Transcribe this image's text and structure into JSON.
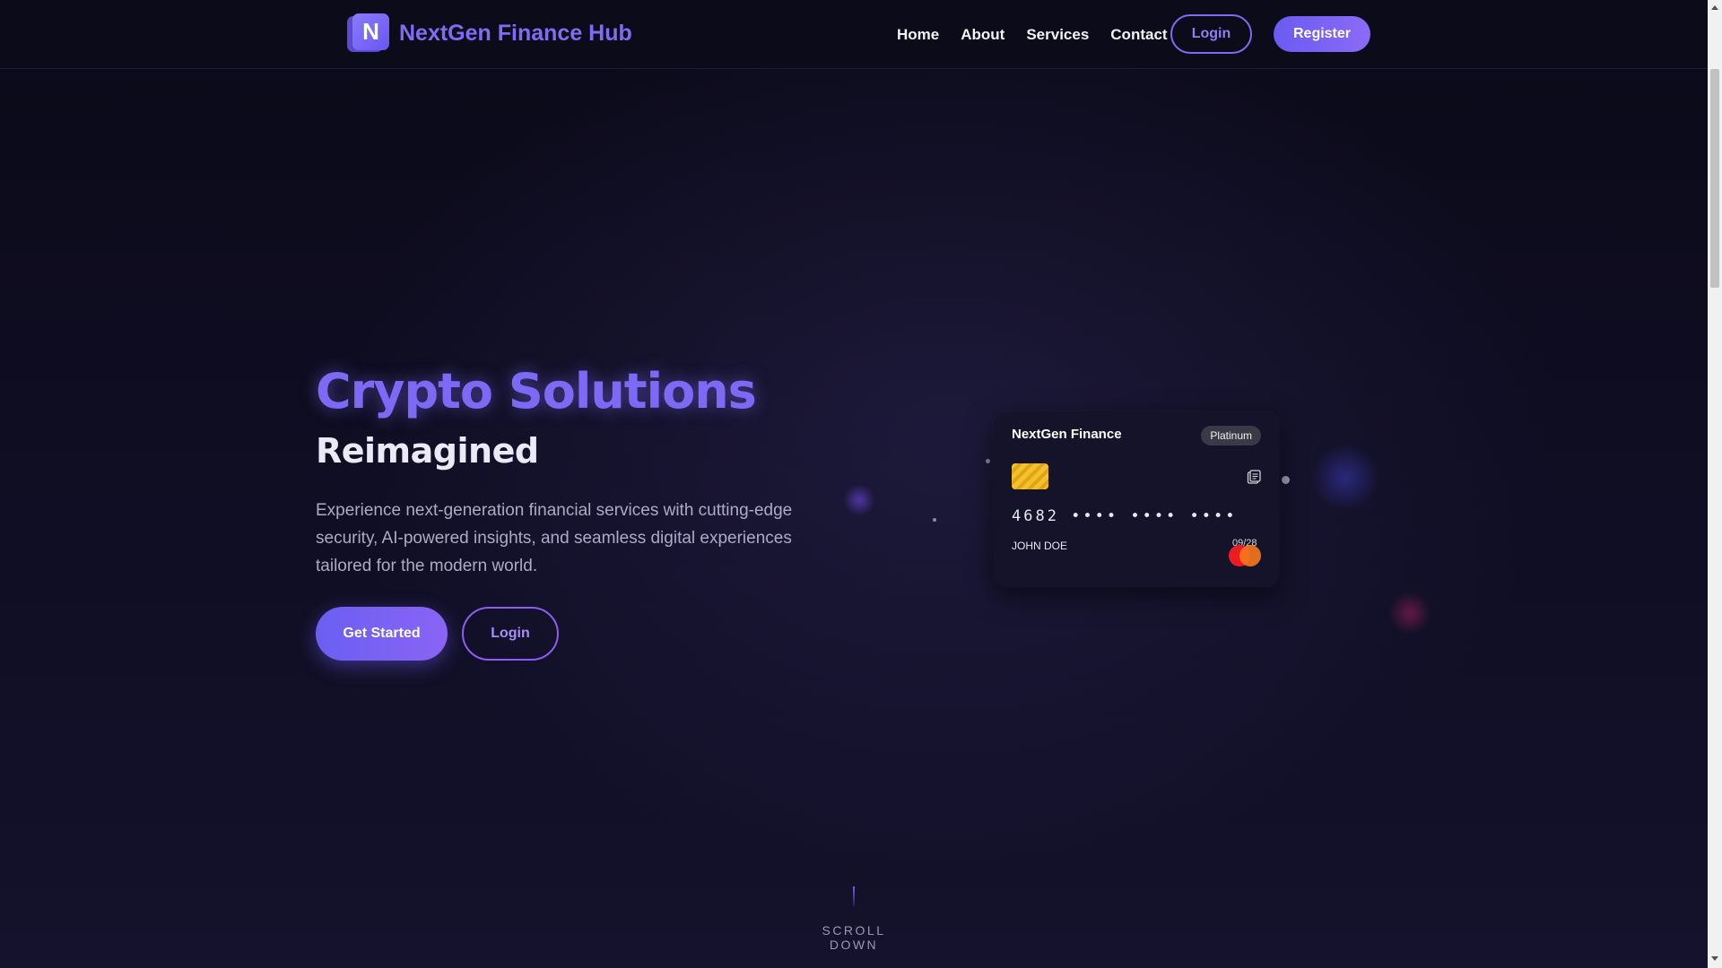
{
  "navbar": {
    "logo_letter": "N",
    "brand_name": "NextGen Finance Hub",
    "links": [
      "Home",
      "About",
      "Services",
      "Contact"
    ],
    "login_label": "Login",
    "register_label": "Register"
  },
  "hero": {
    "title": "Crypto Solutions",
    "subtitle": "Reimagined",
    "description": "Experience next-generation financial services with cutting-edge security, AI-powered insights, and seamless digital experiences tailored for the modern world.",
    "primary_cta": "Get Started",
    "secondary_cta": "Login"
  },
  "card": {
    "bank_name": "NextGen Finance",
    "tier": "Platinum",
    "number": "4682 •••• •••• ••••",
    "holder": "JOHN DOE",
    "expiry": "09/28",
    "chip_icon": "card-chip-icon",
    "contactless_icon": "contactless-icon",
    "network_icon": "mastercard-logo-icon"
  },
  "scroll": {
    "label": "SCROLL DOWN"
  },
  "colors": {
    "accent": "#7c6af6",
    "background": "#0c0b1c",
    "brand": "#7f6cf5"
  }
}
